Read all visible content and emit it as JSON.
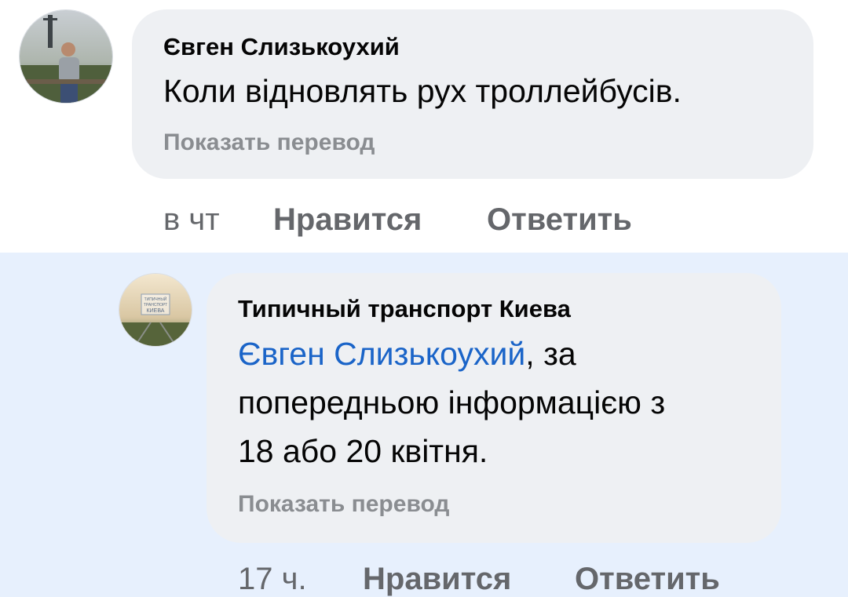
{
  "comment": {
    "author": "Євген Слизькоухий",
    "text": "Коли відновлять рух троллейбусів.",
    "translate_label": "Показать перевод",
    "time": "в чт",
    "like_label": "Нравится",
    "reply_label": "Ответить"
  },
  "reply": {
    "author": "Типичный транспорт Киева",
    "mention": "Євген Слизькоухий",
    "text_after_mention": ", за",
    "text_line2": "попередньою інформацією з",
    "text_line3": "18 або 20 квітня.",
    "translate_label": "Показать перевод",
    "time": "17 ч.",
    "like_label": "Нравится",
    "reply_label": "Ответить",
    "avatar_logo_lines": [
      "ТИПИЧНЫЙ",
      "ТРАНСПОРТ",
      "КИЕВА"
    ]
  },
  "colors": {
    "reply_background": "#e7f0fd",
    "bubble": "#eef0f3",
    "mention": "#1a64c8",
    "secondary_text": "#65676b"
  }
}
